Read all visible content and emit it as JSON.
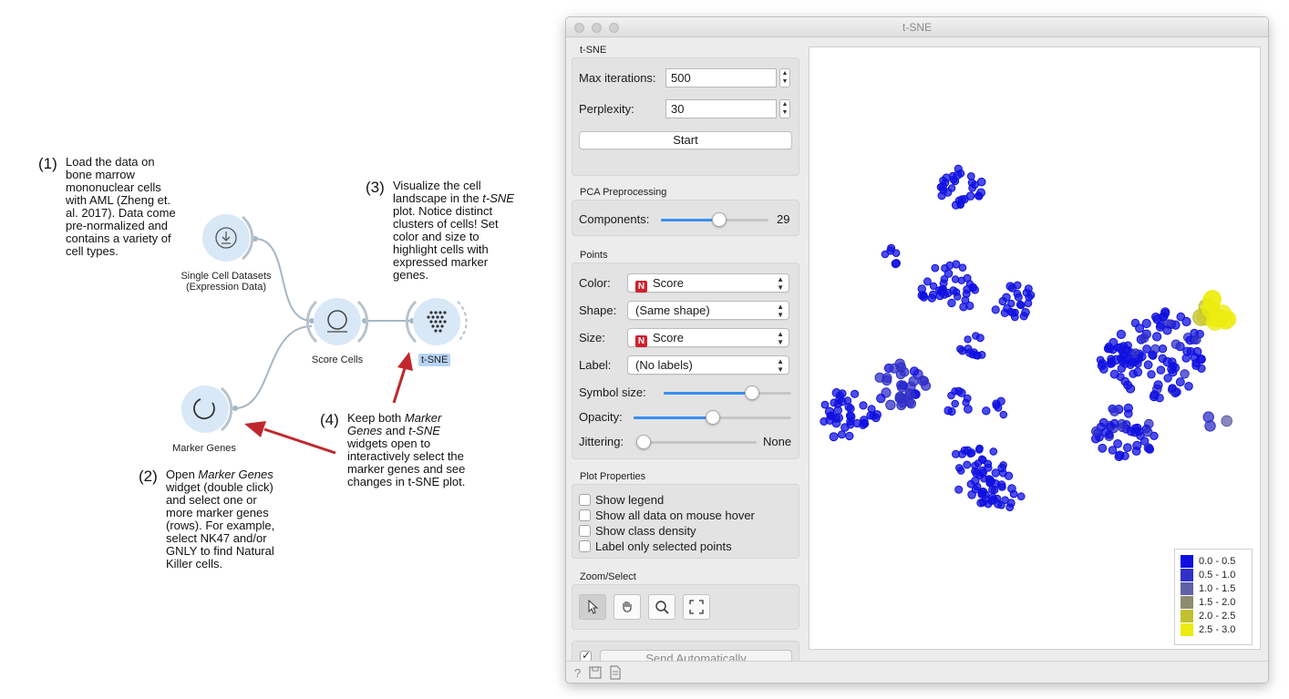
{
  "notes": {
    "n1": {
      "num": "(1)",
      "lines": [
        "Load the data on",
        "bone marrow",
        "mononuclear cells",
        "with AML (Zheng et.",
        "al. 2017). Data come",
        "pre-normalized and",
        "contains a variety of",
        "cell types."
      ]
    },
    "n2": {
      "num": "(2)",
      "line1a": "Open ",
      "line1b": "Marker Genes",
      "lines": [
        "widget (double click)",
        "and select one or",
        "more marker genes",
        "(rows). For example,",
        "select NK47 and/or",
        "GNLY to find Natural",
        "Killer cells."
      ]
    },
    "n3": {
      "num": "(3)",
      "line1": "Visualize the cell",
      "line2a": "landscape in the ",
      "line2b": "t-SNE",
      "lines": [
        "plot. Notice distinct",
        "clusters of cells! Set",
        "color and size to",
        "highlight cells with",
        "expressed marker",
        "genes."
      ]
    },
    "n4": {
      "num": "(4)",
      "line1a": "Keep both ",
      "line1b": "Marker",
      "line2a": "Genes",
      "line2b": " and ",
      "line2c": "t-SNE",
      "lines": [
        "widgets open to",
        "interactively select the",
        "marker genes and see",
        "changes in t-SNE plot."
      ]
    }
  },
  "workflow": {
    "nodes": {
      "single_cell": {
        "line1": "Single Cell Datasets",
        "line2": "(Expression Data)",
        "icon": "download-icon"
      },
      "score_cells": {
        "label": "Score Cells",
        "icon": "circle-icon"
      },
      "tsne": {
        "label": "t-SNE",
        "icon": "dot-grid-icon"
      },
      "marker_genes": {
        "label": "Marker Genes",
        "icon": "spinner-icon"
      }
    },
    "arrow_color": "#c0272d"
  },
  "window": {
    "title": "t-SNE",
    "tsne": {
      "title": "t-SNE",
      "max_iter_label": "Max iterations:",
      "max_iter_value": "500",
      "perplexity_label": "Perplexity:",
      "perplexity_value": "30",
      "start_label": "Start"
    },
    "pca": {
      "title": "PCA Preprocessing",
      "components_label": "Components:",
      "components_value": "29",
      "components_fraction": 0.55
    },
    "points": {
      "title": "Points",
      "color_label": "Color:",
      "color_value": "Score",
      "color_badge": "N",
      "shape_label": "Shape:",
      "shape_value": "(Same shape)",
      "size_label": "Size:",
      "size_value": "Score",
      "size_badge": "N",
      "label_label": "Label:",
      "label_value": "(No labels)",
      "symbol_size_label": "Symbol size:",
      "symbol_size_fraction": 0.72,
      "opacity_label": "Opacity:",
      "opacity_fraction": 0.5,
      "jitter_label": "Jittering:",
      "jitter_value": "None",
      "jitter_fraction": 0.0
    },
    "plot_props": {
      "title": "Plot Properties",
      "options": [
        "Show legend",
        "Show all data on mouse hover",
        "Show class density",
        "Label only selected points"
      ]
    },
    "zoom": {
      "title": "Zoom/Select",
      "tools": [
        "pointer-icon",
        "hand-icon",
        "magnifier-icon",
        "fit-icon"
      ]
    },
    "send": {
      "label": "Send Automatically",
      "checked": true
    },
    "legend": [
      {
        "range": "0.0 - 0.5",
        "color": "#1010e0"
      },
      {
        "range": "0.5 - 1.0",
        "color": "#3030c8"
      },
      {
        "range": "1.0 - 1.5",
        "color": "#6060a8"
      },
      {
        "range": "1.5 - 2.0",
        "color": "#8c8c70"
      },
      {
        "range": "2.0 - 2.5",
        "color": "#c0c030"
      },
      {
        "range": "2.5 - 3.0",
        "color": "#ecec10"
      }
    ],
    "status_icons": [
      "help-icon",
      "save-icon",
      "report-icon"
    ]
  },
  "chart_data": {
    "type": "scatter",
    "title": "",
    "xlabel": "",
    "ylabel": "",
    "color_by": "Score",
    "size_by": "Score",
    "clusters": [
      {
        "cx": 0.33,
        "cy": 0.23,
        "n": 30,
        "score": 0.2
      },
      {
        "cx": 0.31,
        "cy": 0.4,
        "n": 40,
        "score": 0.2
      },
      {
        "cx": 0.45,
        "cy": 0.42,
        "n": 24,
        "score": 0.2
      },
      {
        "cx": 0.18,
        "cy": 0.35,
        "n": 6,
        "score": 0.2
      },
      {
        "cx": 0.09,
        "cy": 0.61,
        "n": 40,
        "score": 0.3
      },
      {
        "cx": 0.2,
        "cy": 0.56,
        "n": 34,
        "score": 0.6
      },
      {
        "cx": 0.36,
        "cy": 0.5,
        "n": 12,
        "score": 0.2
      },
      {
        "cx": 0.33,
        "cy": 0.59,
        "n": 10,
        "score": 0.2
      },
      {
        "cx": 0.41,
        "cy": 0.6,
        "n": 6,
        "score": 0.2
      },
      {
        "cx": 0.68,
        "cy": 0.51,
        "n": 10,
        "score": 0.2
      },
      {
        "cx": 0.7,
        "cy": 0.64,
        "n": 45,
        "score": 0.4
      },
      {
        "cx": 0.69,
        "cy": 0.52,
        "n": 24,
        "score": 0.3
      },
      {
        "cx": 0.77,
        "cy": 0.51,
        "n": 80,
        "score": 0.4
      },
      {
        "cx": 0.37,
        "cy": 0.7,
        "n": 40,
        "score": 0.2
      },
      {
        "cx": 0.42,
        "cy": 0.74,
        "n": 26,
        "score": 0.2
      },
      {
        "cx": 0.9,
        "cy": 0.62,
        "n": 3,
        "score": 1.0
      },
      {
        "cx": 0.9,
        "cy": 0.44,
        "n": 14,
        "score": 2.6
      }
    ],
    "legend_title": "Score"
  }
}
